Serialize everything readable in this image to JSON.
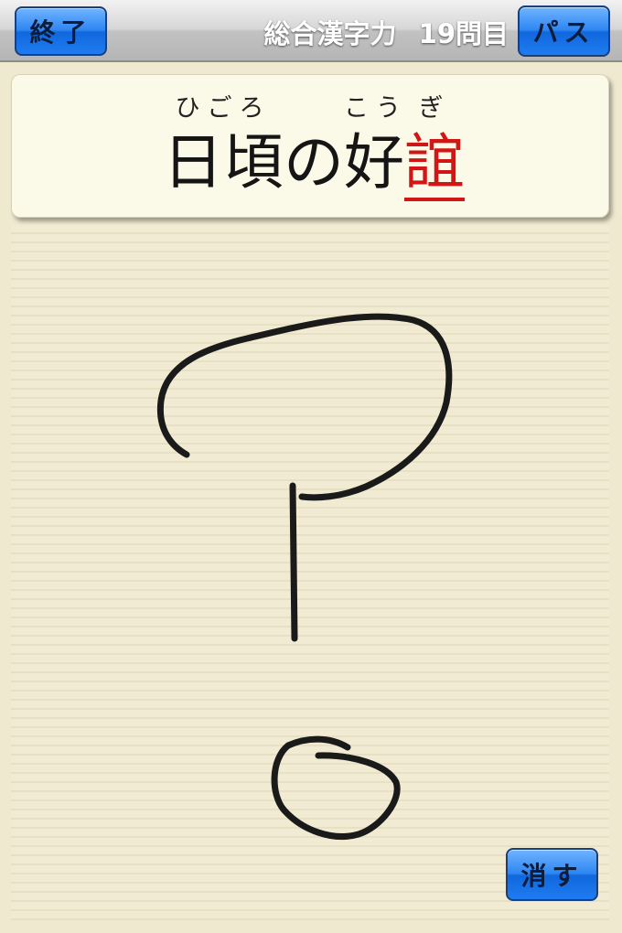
{
  "header": {
    "quit_label": "終了",
    "pass_label": "パス",
    "title": "総合漢字力",
    "question": "19問目"
  },
  "question": {
    "parts": [
      {
        "text": "日頃",
        "reading": "ひごろ"
      },
      {
        "text": "の",
        "reading": ""
      },
      {
        "text": "好",
        "reading": "こう"
      },
      {
        "text": "誼",
        "reading": "ぎ"
      }
    ]
  },
  "footer": {
    "erase_label": "消す"
  },
  "colors": {
    "button_blue": "#1f7cf0",
    "highlight_red": "#d21515",
    "paper": "#efe9cf"
  }
}
